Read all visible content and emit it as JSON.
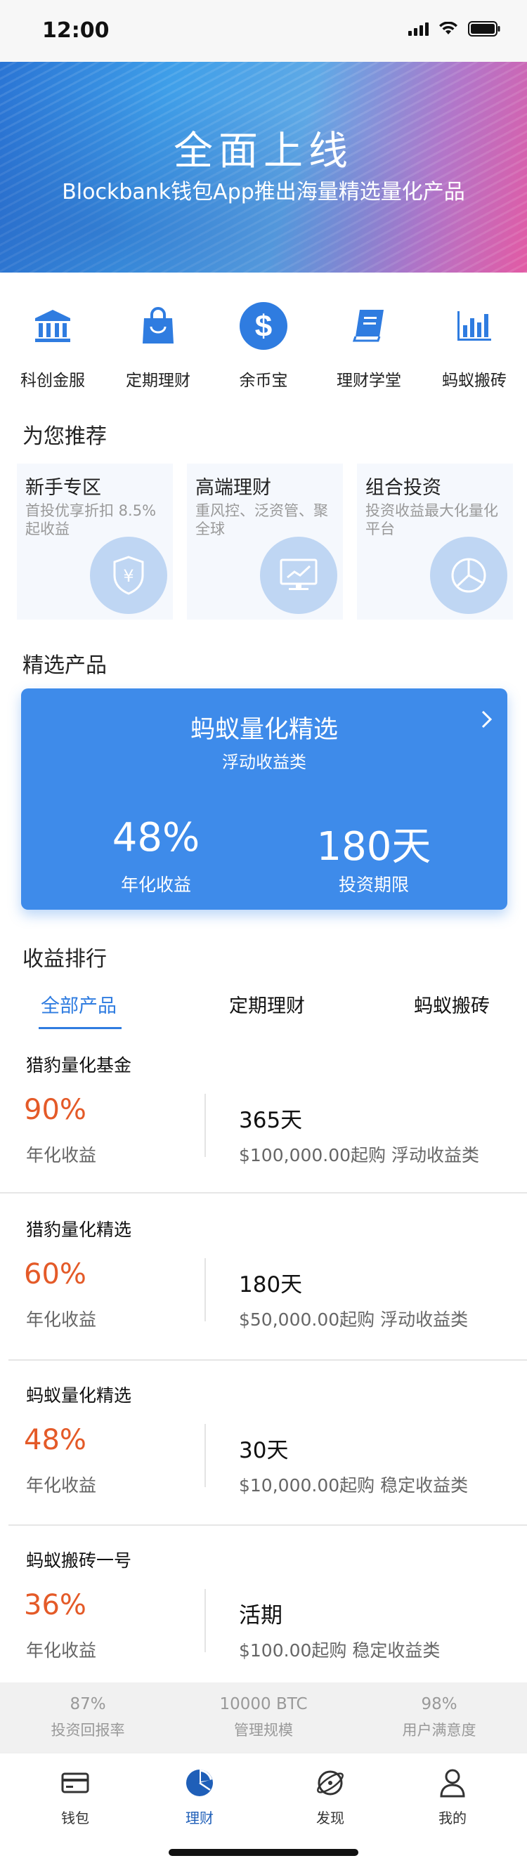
{
  "status_bar": {
    "time": "12:00"
  },
  "banner": {
    "title": "全面上线",
    "subtitle": "Blockbank钱包App推出海量精选量化产品"
  },
  "quick_menu": [
    {
      "label": "科创金服",
      "icon": "bank-icon"
    },
    {
      "label": "定期理财",
      "icon": "shopping-bag-icon"
    },
    {
      "label": "余币宝",
      "icon": "dollar-coin-icon"
    },
    {
      "label": "理财学堂",
      "icon": "book-icon"
    },
    {
      "label": "蚂蚁搬砖",
      "icon": "bar-chart-icon"
    }
  ],
  "recommend": {
    "title": "为您推荐",
    "cards": [
      {
        "title": "新手专区",
        "desc": "首投优享折扣 8.5%起收益",
        "icon": "yen-shield-icon"
      },
      {
        "title": "高端理财",
        "desc": "重风控、泛资管、聚全球",
        "icon": "monitor-chart-icon"
      },
      {
        "title": "组合投资",
        "desc": "投资收益最大化量化平台",
        "icon": "pie-chart-icon"
      }
    ]
  },
  "featured": {
    "section_title": "精选产品",
    "name": "蚂蚁量化精选",
    "category": "浮动收益类",
    "rate": "48%",
    "rate_label": "年化收益",
    "term": "180天",
    "term_label": "投资期限"
  },
  "ranking": {
    "title": "收益排行",
    "tabs": [
      "全部产品",
      "定期理财",
      "蚂蚁搬砖"
    ],
    "active_tab": 0,
    "products": [
      {
        "name": "猎豹量化基金",
        "rate": "90%",
        "rate_label": "年化收益",
        "term": "365天",
        "info": "$100,000.00起购 浮动收益类"
      },
      {
        "name": "猎豹量化精选",
        "rate": "60%",
        "rate_label": "年化收益",
        "term": "180天",
        "info": "$50,000.00起购 浮动收益类"
      },
      {
        "name": "蚂蚁量化精选",
        "rate": "48%",
        "rate_label": "年化收益",
        "term": "30天",
        "info": "$10,000.00起购 稳定收益类"
      },
      {
        "name": "蚂蚁搬砖一号",
        "rate": "36%",
        "rate_label": "年化收益",
        "term": "活期",
        "info": "$100.00起购 稳定收益类"
      }
    ]
  },
  "stats": [
    {
      "value": "87%",
      "label": "投资回报率"
    },
    {
      "value": "10000 BTC",
      "label": "管理规模"
    },
    {
      "value": "98%",
      "label": "用户满意度"
    }
  ],
  "tab_bar": {
    "items": [
      {
        "label": "钱包",
        "icon": "wallet-icon"
      },
      {
        "label": "理财",
        "icon": "pie-chart-icon"
      },
      {
        "label": "发现",
        "icon": "planet-icon"
      },
      {
        "label": "我的",
        "icon": "user-icon"
      }
    ],
    "active": 1
  },
  "colors": {
    "accent": "#3e8bea",
    "rate": "#e45a28",
    "tab_active": "#2f7ce0"
  }
}
